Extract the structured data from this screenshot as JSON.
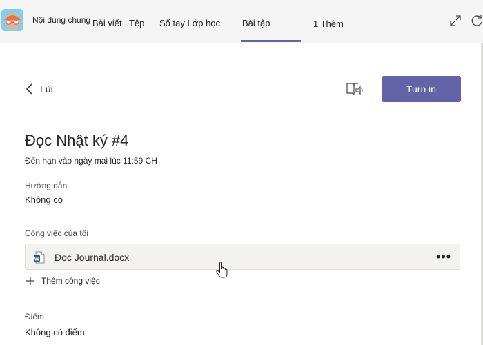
{
  "header": {
    "team_name": "Nội dung chung",
    "tabs": [
      {
        "label": "Bài viết"
      },
      {
        "label": "Tệp"
      },
      {
        "label": "Sổ tay Lớp học"
      },
      {
        "label": "Bài tập",
        "active": true
      }
    ],
    "more_label": "1 Thêm",
    "icons": [
      "expand-icon",
      "refresh-icon"
    ]
  },
  "assignment": {
    "back_label": "Lùi",
    "turn_in_label": "Turn in",
    "title": "Đọc Nhật ký #4",
    "due": "Đến hạn vào ngày mai lúc 11:59 CH",
    "instructions_label": "Hướng dẫn",
    "instructions_value": "Không có",
    "my_work_label": "Công việc của tôi",
    "file_name": "Đọc Journal.docx",
    "more_label": "•••",
    "add_work_label": "Thêm công việc",
    "points_label": "Điểm",
    "points_value": "Không có điểm"
  },
  "colors": {
    "accent": "#6264a7",
    "word_blue": "#2b579a"
  }
}
